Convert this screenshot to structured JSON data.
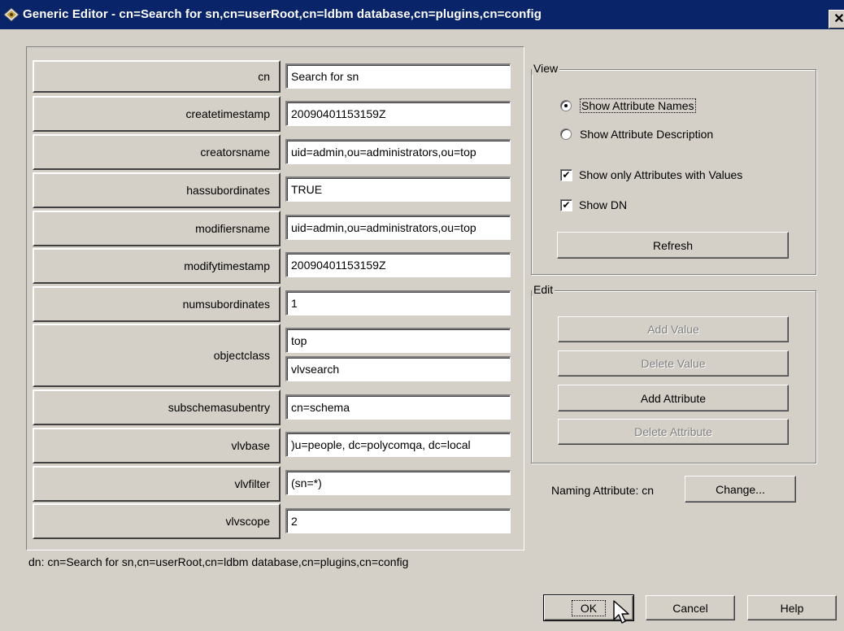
{
  "window": {
    "title": "Generic Editor - cn=Search for sn,cn=userRoot,cn=ldbm database,cn=plugins,cn=config",
    "close_glyph": "✕"
  },
  "attributes": [
    {
      "name": "cn",
      "values": [
        "Search for sn"
      ]
    },
    {
      "name": "createtimestamp",
      "values": [
        "20090401153159Z"
      ]
    },
    {
      "name": "creatorsname",
      "values": [
        "uid=admin,ou=administrators,ou=top"
      ]
    },
    {
      "name": "hassubordinates",
      "values": [
        "TRUE"
      ]
    },
    {
      "name": "modifiersname",
      "values": [
        "uid=admin,ou=administrators,ou=top"
      ]
    },
    {
      "name": "modifytimestamp",
      "values": [
        "20090401153159Z"
      ]
    },
    {
      "name": "numsubordinates",
      "values": [
        "1"
      ]
    },
    {
      "name": "objectclass",
      "values": [
        "top",
        "vlvsearch"
      ]
    },
    {
      "name": "subschemasubentry",
      "values": [
        "cn=schema"
      ]
    },
    {
      "name": "vlvbase",
      "values": [
        ")u=people, dc=polycomqa, dc=local"
      ]
    },
    {
      "name": "vlvfilter",
      "values": [
        "(sn=*)"
      ]
    },
    {
      "name": "vlvscope",
      "values": [
        "2"
      ]
    }
  ],
  "view": {
    "title": "View",
    "show_attribute_names": "Show Attribute Names",
    "show_attribute_description": "Show Attribute Description",
    "selected_radio": "names",
    "show_only_with_values": "Show only Attributes with Values",
    "show_only_with_values_checked": true,
    "show_dn": "Show DN",
    "show_dn_checked": true,
    "refresh": "Refresh"
  },
  "edit": {
    "title": "Edit",
    "add_value": "Add Value",
    "delete_value": "Delete Value",
    "add_attribute": "Add Attribute",
    "delete_attribute": "Delete Attribute"
  },
  "naming": {
    "label": "Naming Attribute: cn",
    "change": "Change..."
  },
  "dn_text": "dn: cn=Search for sn,cn=userRoot,cn=ldbm database,cn=plugins,cn=config",
  "footer": {
    "ok": "OK",
    "cancel": "Cancel",
    "help": "Help"
  },
  "icons": {
    "title": "editor-app-icon",
    "check_glyph": "✔"
  }
}
